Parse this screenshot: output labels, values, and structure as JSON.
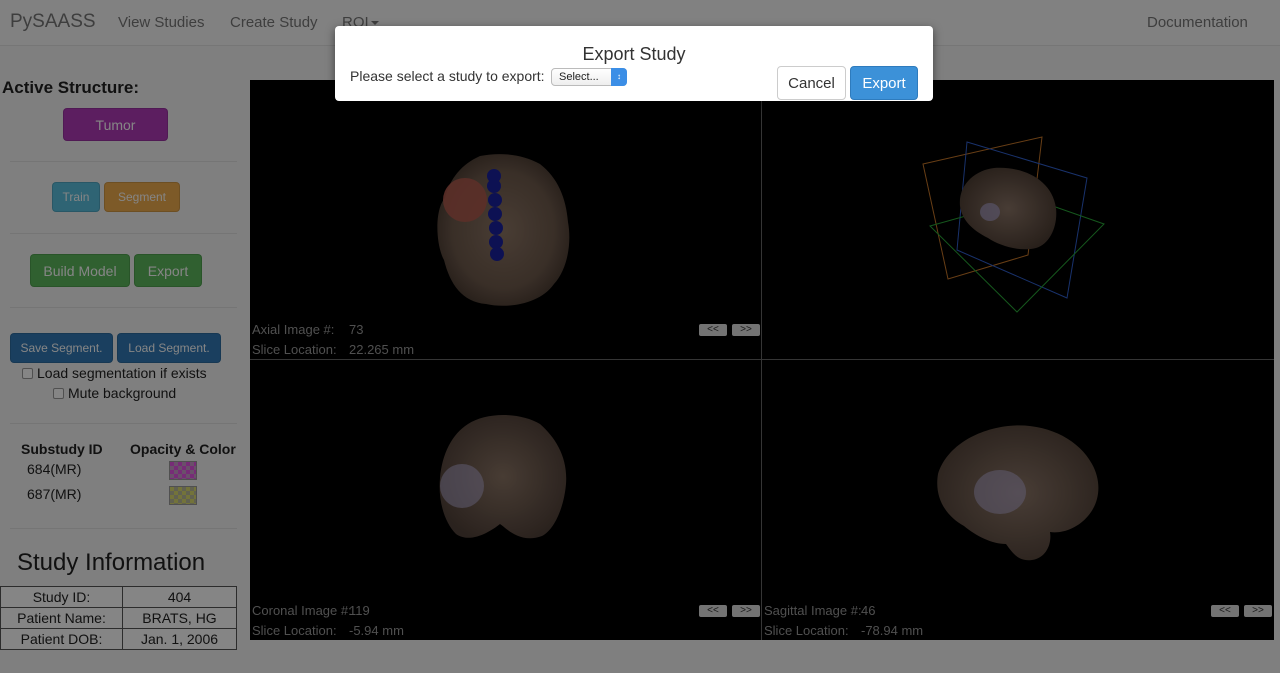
{
  "navbar": {
    "brand": "PySAASS",
    "links": [
      "View Studies",
      "Create Study",
      "ROI"
    ],
    "documentation": "Documentation"
  },
  "sidebar": {
    "active_structure_label": "Active Structure:",
    "active_structure_button": "Tumor",
    "train_label": "Train",
    "segment_label": "Segment",
    "build_model_label": "Build Model",
    "export_label": "Export",
    "save_segment_label": "Save Segment.",
    "load_segment_label": "Load Segment.",
    "load_if_exists_label": "Load segmentation if exists",
    "mute_background_label": "Mute background",
    "substudy_header": "Substudy ID",
    "opacity_header": "Opacity & Color",
    "substudies": [
      {
        "id": "684(MR)",
        "color": "#e455e4"
      },
      {
        "id": "687(MR)",
        "color": "#dcdc70"
      }
    ]
  },
  "study_info": {
    "title": "Study Information",
    "rows": [
      {
        "label": "Study ID:",
        "value": "404"
      },
      {
        "label": "Patient Name:",
        "value": "BRATS, HG"
      },
      {
        "label": "Patient DOB:",
        "value": "Jan. 1, 2006"
      }
    ]
  },
  "viewer": {
    "axial": {
      "label": "Axial Image #:",
      "number": "73",
      "slice_label": "Slice Location:",
      "slice_value": "22.265 mm"
    },
    "coronal": {
      "label": "Coronal Image #:",
      "number": "119",
      "slice_label": "Slice Location:",
      "slice_value": "-5.94 mm"
    },
    "sagittal": {
      "label": "Sagittal Image #:",
      "number": "46",
      "slice_label": "Slice Location:",
      "slice_value": "-78.94 mm"
    },
    "prev_label": "<<",
    "next_label": ">>"
  },
  "modal": {
    "title": "Export Study",
    "prompt": "Please select a study to export:",
    "select_value": "Select...",
    "cancel_label": "Cancel",
    "export_label": "Export"
  },
  "colors": {
    "tumor": "#b03ab8",
    "primary": "#3c91d8",
    "success": "#5cb85c",
    "info": "#5bc0de",
    "warning": "#f0ad4e"
  },
  "icons": [
    "caret-down-icon",
    "select-arrows-icon"
  ]
}
